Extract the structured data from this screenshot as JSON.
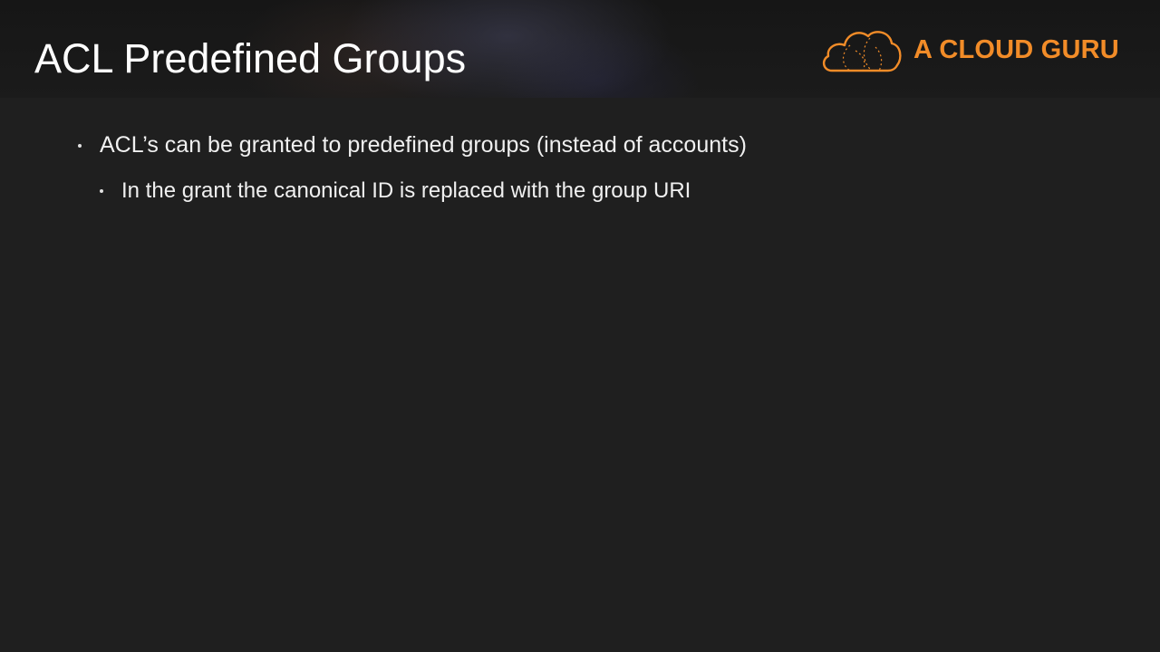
{
  "slide": {
    "title": "ACL Predefined Groups",
    "logo": {
      "icon": "cloud-logo-icon",
      "text": "A CLOUD GURU",
      "color": "#f28c28"
    },
    "bullets": [
      {
        "level": 1,
        "text": "ACL’s can be granted to predefined groups (instead of accounts)"
      },
      {
        "level": 2,
        "text": "In the grant the canonical ID is replaced with the group URI"
      }
    ]
  }
}
